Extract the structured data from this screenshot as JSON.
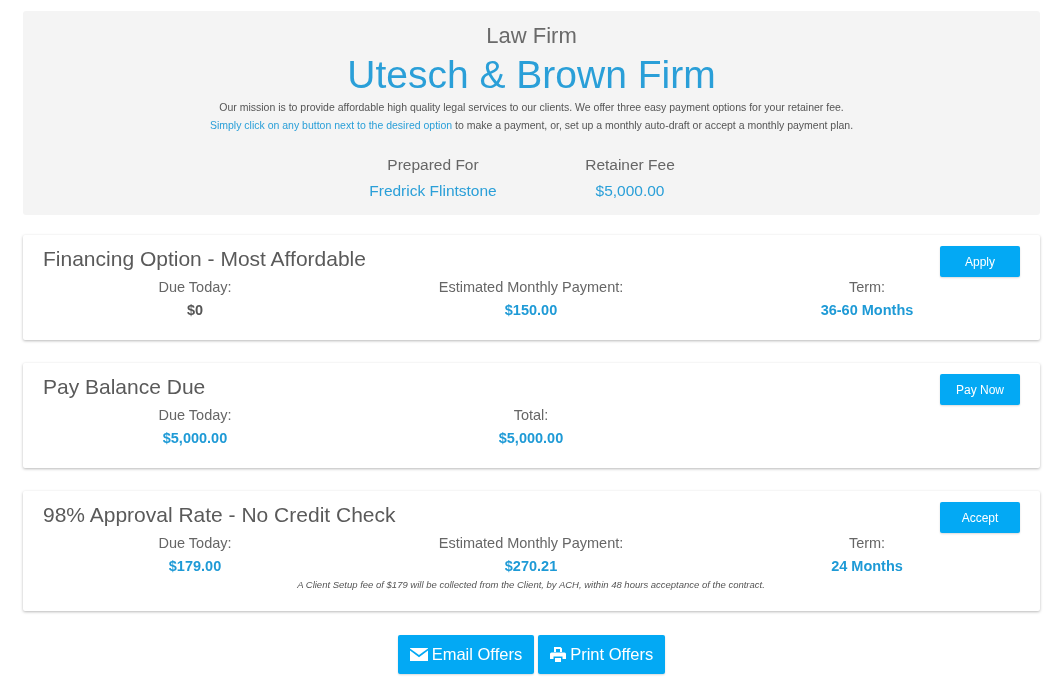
{
  "header": {
    "kicker": "Law Firm",
    "firm_name": "Utesch & Brown Firm",
    "mission": "Our mission is to provide affordable high quality legal services to our clients. We offer three easy payment options for your retainer fee.",
    "instruction_link": "Simply click on any button next to the desired option",
    "instruction_rest": "to make a payment, or, set up a monthly auto-draft or accept a monthly payment plan."
  },
  "summary": [
    {
      "label": "Prepared For",
      "value": "Fredrick Flintstone"
    },
    {
      "label": "Retainer Fee",
      "value": "$5,000.00"
    }
  ],
  "offers": [
    {
      "title": "Financing Option - Most Affordable",
      "button": "Apply",
      "fields": [
        {
          "label": "Due Today:",
          "value": "$0",
          "highlighted": false
        },
        {
          "label": "Estimated Monthly Payment:",
          "value": "$150.00",
          "highlighted": true
        },
        {
          "label": "Term:",
          "value": "36-60 Months",
          "highlighted": true
        }
      ]
    },
    {
      "title": "Pay Balance Due",
      "button": "Pay Now",
      "fields": [
        {
          "label": "Due Today:",
          "value": "$5,000.00",
          "highlighted": true
        },
        {
          "label": "Total:",
          "value": "$5,000.00",
          "highlighted": true
        }
      ]
    },
    {
      "title": "98% Approval Rate - No Credit Check",
      "button": "Accept",
      "fields": [
        {
          "label": "Due Today:",
          "value": "$179.00",
          "highlighted": true
        },
        {
          "label": "Estimated Monthly Payment:",
          "value": "$270.21",
          "highlighted": true
        },
        {
          "label": "Term:",
          "value": "24 Months",
          "highlighted": true
        }
      ],
      "note": "A Client Setup fee of $179 will be collected from the Client, by ACH, within 48 hours acceptance of the contract."
    }
  ],
  "actions": [
    {
      "label": "Email Offers",
      "kind": "email"
    },
    {
      "label": "Print Offers",
      "kind": "print"
    }
  ]
}
